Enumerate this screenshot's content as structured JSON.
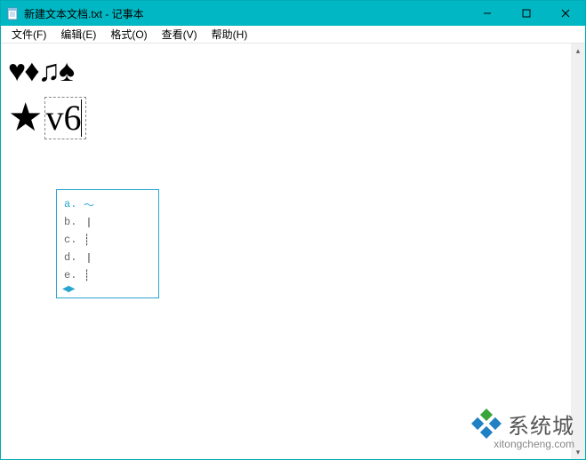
{
  "window": {
    "title": "新建文本文档.txt - 记事本"
  },
  "win_controls": {
    "minimize": "—",
    "maximize": "□",
    "close": "×"
  },
  "menu": {
    "file": "文件(F)",
    "edit": "编辑(E)",
    "format": "格式(O)",
    "view": "查看(V)",
    "help": "帮助(H)"
  },
  "content": {
    "line1": "♥♦♫♠",
    "star": "★",
    "typed": "v6"
  },
  "ime": {
    "candidates": [
      {
        "label": "a.",
        "text": "〜",
        "selected": true
      },
      {
        "label": "b.",
        "text": "丨",
        "selected": false
      },
      {
        "label": "c.",
        "text": "┊",
        "selected": false
      },
      {
        "label": "d.",
        "text": "丨",
        "selected": false
      },
      {
        "label": "e.",
        "text": "┊",
        "selected": false
      }
    ],
    "pager_left": "◀",
    "pager_right": "▶"
  },
  "scrollbar": {
    "up": "▴",
    "down": "▾"
  },
  "watermark": {
    "brand": "系统城",
    "url": "xitongcheng.com"
  }
}
